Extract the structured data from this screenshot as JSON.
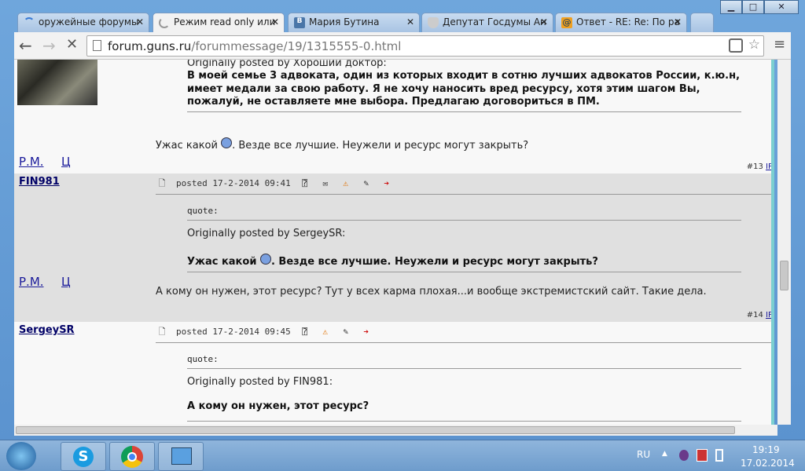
{
  "tabs": [
    {
      "label": "оружейные форумы",
      "icon": "loading-icon"
    },
    {
      "label": "Режим read only или",
      "icon": "loading-icon",
      "active": true
    },
    {
      "label": "Мария Бутина",
      "icon": "vk-icon"
    },
    {
      "label": "Депутат Госдумы Ан",
      "icon": "shield-icon"
    },
    {
      "label": "Ответ - RE: Re: По ра",
      "icon": "mail-icon"
    }
  ],
  "address": {
    "host": "forum.guns.ru",
    "path": "/forummessage/19/1315555-0.html"
  },
  "posts": [
    {
      "quote_author": "Originally posted by Хороший доктор:",
      "quote_text": [
        "В моей семье 3 адвоката, один из которых входит в сотню лучших адвокатов России, к.ю.н,",
        "имеет медали за свою работу. Я не хочу наносить вред ресурсу, хотя этим шагом Вы,",
        "пожалуй, не оставляете мне выбора. Предлагаю договориться в ПМ."
      ],
      "body_before": "Ужас какой",
      "body_after": ". Везде все лучшие. Неужели и ресурс могут закрыть?",
      "links": [
        "Р.М.",
        "Ц"
      ],
      "number": "#13",
      "ip": "IP"
    },
    {
      "user": "FIN981",
      "posted": "posted 17-2-2014 09:41",
      "quote_label": "quote:",
      "quote_author": "Originally posted by SergeySR:",
      "quote_before": "Ужас какой",
      "quote_after": ". Везде все лучшие. Неужели и ресурс могут закрыть?",
      "body": "А кому он нужен, этот ресурс? Тут у всех карма плохая...и вообще экстремистский сайт. Такие дела.",
      "links": [
        "Р.М.",
        "Ц"
      ],
      "number": "#14",
      "ip": "IP"
    },
    {
      "user": "SergeySR",
      "posted": "posted 17-2-2014 09:45",
      "quote_label": "quote:",
      "quote_author": "Originally posted by FIN981:",
      "quote_text": "А кому он нужен, этот ресурс?"
    }
  ],
  "taskbar": {
    "lang": "RU",
    "time": "19:19",
    "date": "17.02.2014"
  },
  "colors": {
    "accent": "#7bcfd0",
    "alt_row": "#e0e0e0",
    "link": "#000066"
  }
}
